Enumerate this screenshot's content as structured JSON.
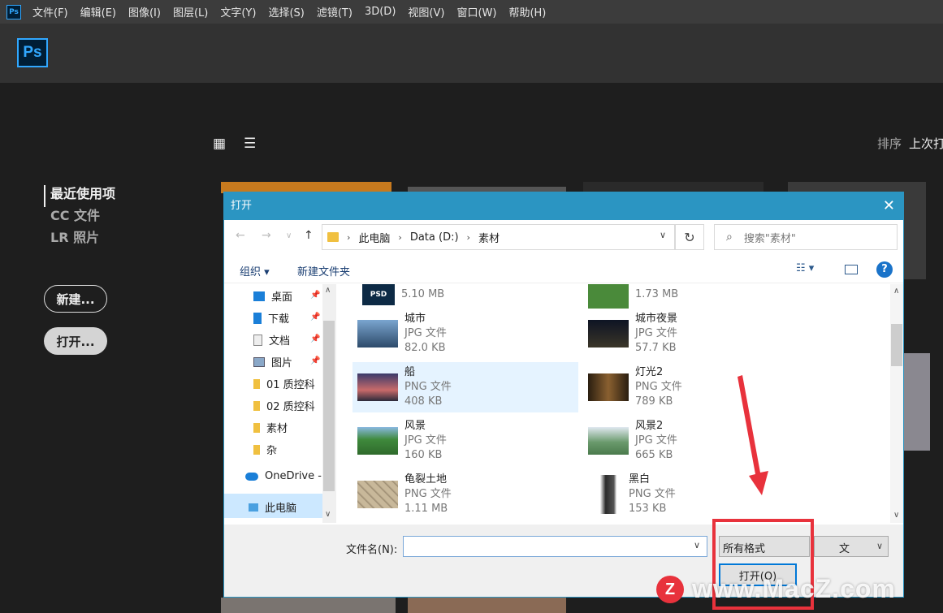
{
  "app": {
    "mini_logo": "Ps",
    "logo": "Ps"
  },
  "menu": [
    "文件(F)",
    "编辑(E)",
    "图像(I)",
    "图层(L)",
    "文字(Y)",
    "选择(S)",
    "滤镜(T)",
    "3D(D)",
    "视图(V)",
    "窗口(W)",
    "帮助(H)"
  ],
  "home": {
    "nav": [
      "最近使用项",
      "CC 文件",
      "LR 照片"
    ],
    "new_button": "新建...",
    "open_button": "打开...",
    "sort_label": "排序",
    "sort_value": "上次打"
  },
  "dialog": {
    "title": "打开",
    "close": "✕",
    "breadcrumb": [
      "此电脑",
      "Data (D:)",
      "素材"
    ],
    "search_placeholder": "搜索\"素材\"",
    "toolbar": {
      "organize": "组织 ▾",
      "new_folder": "新建文件夹",
      "help": "?"
    },
    "navpane": [
      {
        "label": "桌面",
        "icon": "desktop-icon",
        "pinned": true
      },
      {
        "label": "下载",
        "icon": "download-icon",
        "pinned": true
      },
      {
        "label": "文档",
        "icon": "document-icon",
        "pinned": true
      },
      {
        "label": "图片",
        "icon": "pictures-icon",
        "pinned": true
      },
      {
        "label": "01 质控科",
        "icon": "folder-icon",
        "pinned": false
      },
      {
        "label": "02 质控科",
        "icon": "folder-icon",
        "pinned": false
      },
      {
        "label": "素材",
        "icon": "folder-icon",
        "pinned": false
      },
      {
        "label": "杂",
        "icon": "folder-icon",
        "pinned": false
      },
      {
        "label": "OneDrive -",
        "icon": "cloud-icon",
        "pinned": false
      },
      {
        "label": "此电脑",
        "icon": "computer-icon",
        "pinned": false
      }
    ],
    "files": [
      {
        "name": "",
        "type": "",
        "size": "5.10 MB",
        "thumb_color": "#0d2a45"
      },
      {
        "name": "",
        "type": "",
        "size": "1.73 MB",
        "thumb_color": "#4a8a3a"
      },
      {
        "name": "城市",
        "type": "JPG 文件",
        "size": "82.0 KB",
        "thumb_color": "#4a6f96"
      },
      {
        "name": "城市夜景",
        "type": "JPG 文件",
        "size": "57.7 KB",
        "thumb_color": "#1a2438"
      },
      {
        "name": "船",
        "type": "PNG 文件",
        "size": "408 KB",
        "thumb_color": "#6b3a5a"
      },
      {
        "name": "灯光2",
        "type": "PNG 文件",
        "size": "789 KB",
        "thumb_color": "#3a2a18"
      },
      {
        "name": "风景",
        "type": "JPG 文件",
        "size": "160 KB",
        "thumb_color": "#3f8a3c"
      },
      {
        "name": "风景2",
        "type": "JPG 文件",
        "size": "665 KB",
        "thumb_color": "#6a9a6c"
      },
      {
        "name": "龟裂土地",
        "type": "PNG 文件",
        "size": "1.11 MB",
        "thumb_color": "#b5a48a"
      },
      {
        "name": "黑白",
        "type": "PNG 文件",
        "size": "153 KB",
        "thumb_color": "#5a5a5a"
      }
    ],
    "selected_file": "船",
    "filename_label": "文件名(N):",
    "format_value": "所有格式",
    "format_value2": "文",
    "open_button": "打开(O)"
  },
  "watermark": {
    "badge": "Z",
    "text": "www.MacZ.com"
  }
}
